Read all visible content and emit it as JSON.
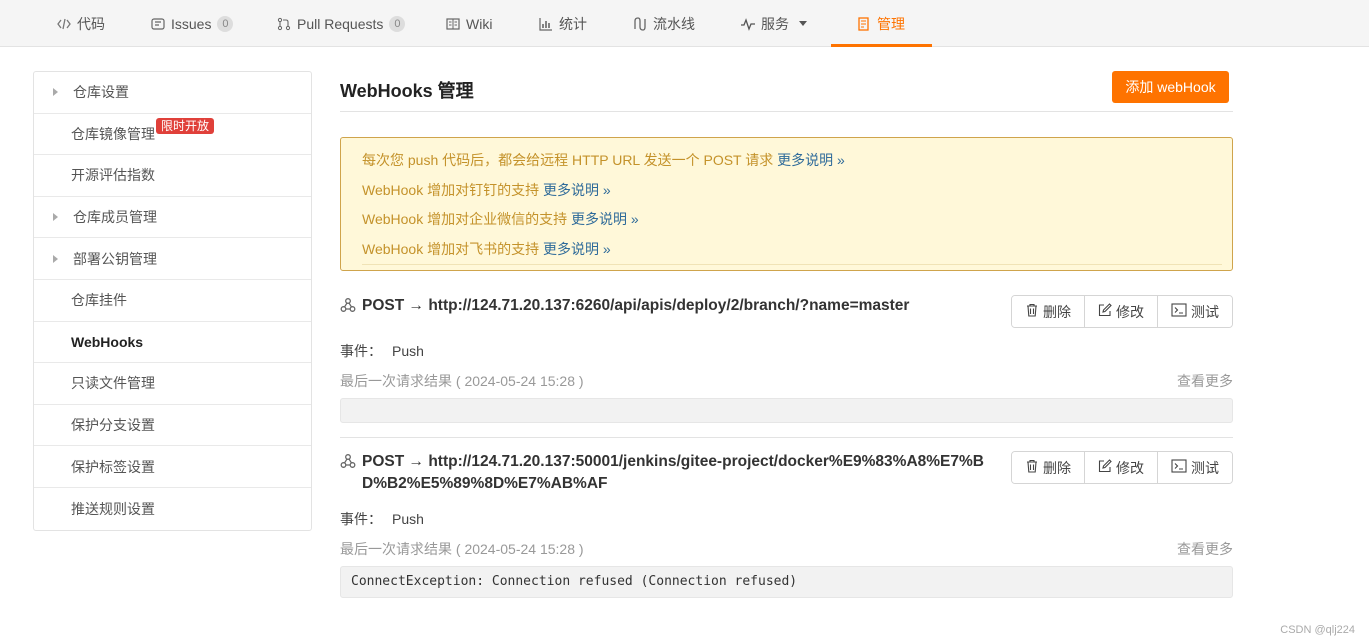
{
  "topnav": {
    "items": [
      {
        "label": "代码",
        "icon": "code-icon"
      },
      {
        "label": "Issues",
        "count": "0",
        "icon": "issues-icon"
      },
      {
        "label": "Pull Requests",
        "count": "0",
        "icon": "pull-request-icon"
      },
      {
        "label": "Wiki",
        "icon": "wiki-icon"
      },
      {
        "label": "统计",
        "icon": "chart-icon"
      },
      {
        "label": "流水线",
        "icon": "pipeline-icon"
      },
      {
        "label": "服务",
        "icon": "pulse-icon"
      },
      {
        "label": "管理",
        "icon": "manage-icon"
      }
    ],
    "active_color": "#fe7300"
  },
  "sidebar": {
    "items": [
      {
        "label": "仓库设置"
      },
      {
        "label": "仓库镜像管理",
        "badge": "限时开放"
      },
      {
        "label": "开源评估指数"
      },
      {
        "label": "仓库成员管理"
      },
      {
        "label": "部署公钥管理"
      },
      {
        "label": "仓库挂件"
      },
      {
        "label": "WebHooks"
      },
      {
        "label": "只读文件管理"
      },
      {
        "label": "保护分支设置"
      },
      {
        "label": "保护标签设置"
      },
      {
        "label": "推送规则设置"
      }
    ]
  },
  "main": {
    "title": "WebHooks 管理",
    "add_button": "添加 webHook",
    "notices": [
      {
        "text": "每次您 push 代码后，都会给远程 HTTP URL 发送一个 POST 请求",
        "more": "更多说明 »"
      },
      {
        "text": "WebHook 增加对钉钉的支持",
        "more": "更多说明 »"
      },
      {
        "text": "WebHook 增加对企业微信的支持",
        "more": "更多说明 »"
      },
      {
        "text": "WebHook 增加对飞书的支持",
        "more": "更多说明 »"
      }
    ],
    "buttons": {
      "delete": "删除",
      "edit": "修改",
      "test": "测试"
    },
    "hooks": [
      {
        "url": "POST → http://124.71.20.137:6260/api/apis/deploy/2/branch/?name=master",
        "event_label": "事件：",
        "event": "Push",
        "last_result": "最后一次请求结果 ( 2024-05-24 15:28 )",
        "more": "查看更多",
        "result": ""
      },
      {
        "url": "POST → http://124.71.20.137:50001/jenkins/gitee-project/docker%E9%83%A8%E7%BD%B2%E5%89%8D%E7%AB%AF",
        "event_label": "事件：",
        "event": "Push",
        "last_result": "最后一次请求结果 ( 2024-05-24 15:28 )",
        "more": "查看更多",
        "result": "ConnectException: Connection refused (Connection refused)"
      }
    ]
  },
  "watermark": "CSDN @qlj224"
}
